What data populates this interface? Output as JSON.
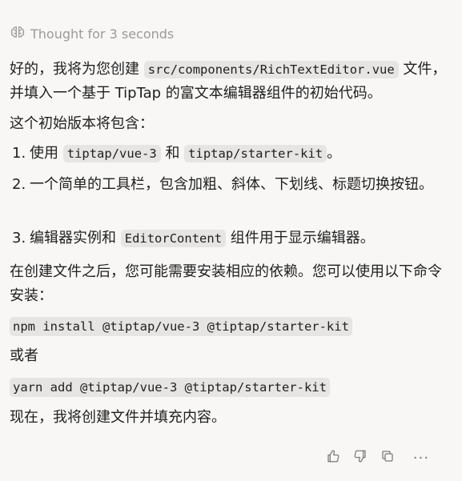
{
  "thought": {
    "label": "Thought for 3 seconds"
  },
  "intro": {
    "part1": "好的，我将为您创建 ",
    "file_path": "src/components/RichTextEditor.vue",
    "part2": " 文件，并填入一个基于 TipTap 的富文本编辑器组件的初始代码。"
  },
  "contains_label": "这个初始版本将包含：",
  "list": [
    {
      "number": "1.",
      "before": "使用 ",
      "code1": "tiptap/vue-3",
      "middle": " 和 ",
      "code2": "tiptap/starter-kit",
      "after": "。"
    },
    {
      "number": "2.",
      "text": "一个简单的工具栏，包含加粗、斜体、下划线、标题切换按钮。"
    },
    {
      "number": "3.",
      "before": "编辑器实例和 ",
      "code": "EditorContent",
      "after": " 组件用于显示编辑器。"
    }
  ],
  "install_note": "在创建文件之后，您可能需要安装相应的依赖。您可以使用以下命令安装：",
  "npm_command": "npm install @tiptap/vue-3 @tiptap/starter-kit",
  "or_label": "或者",
  "yarn_command": "yarn add @tiptap/vue-3 @tiptap/starter-kit",
  "closing": "现在，我将创建文件并填充内容。",
  "actions": {
    "more": "···"
  }
}
